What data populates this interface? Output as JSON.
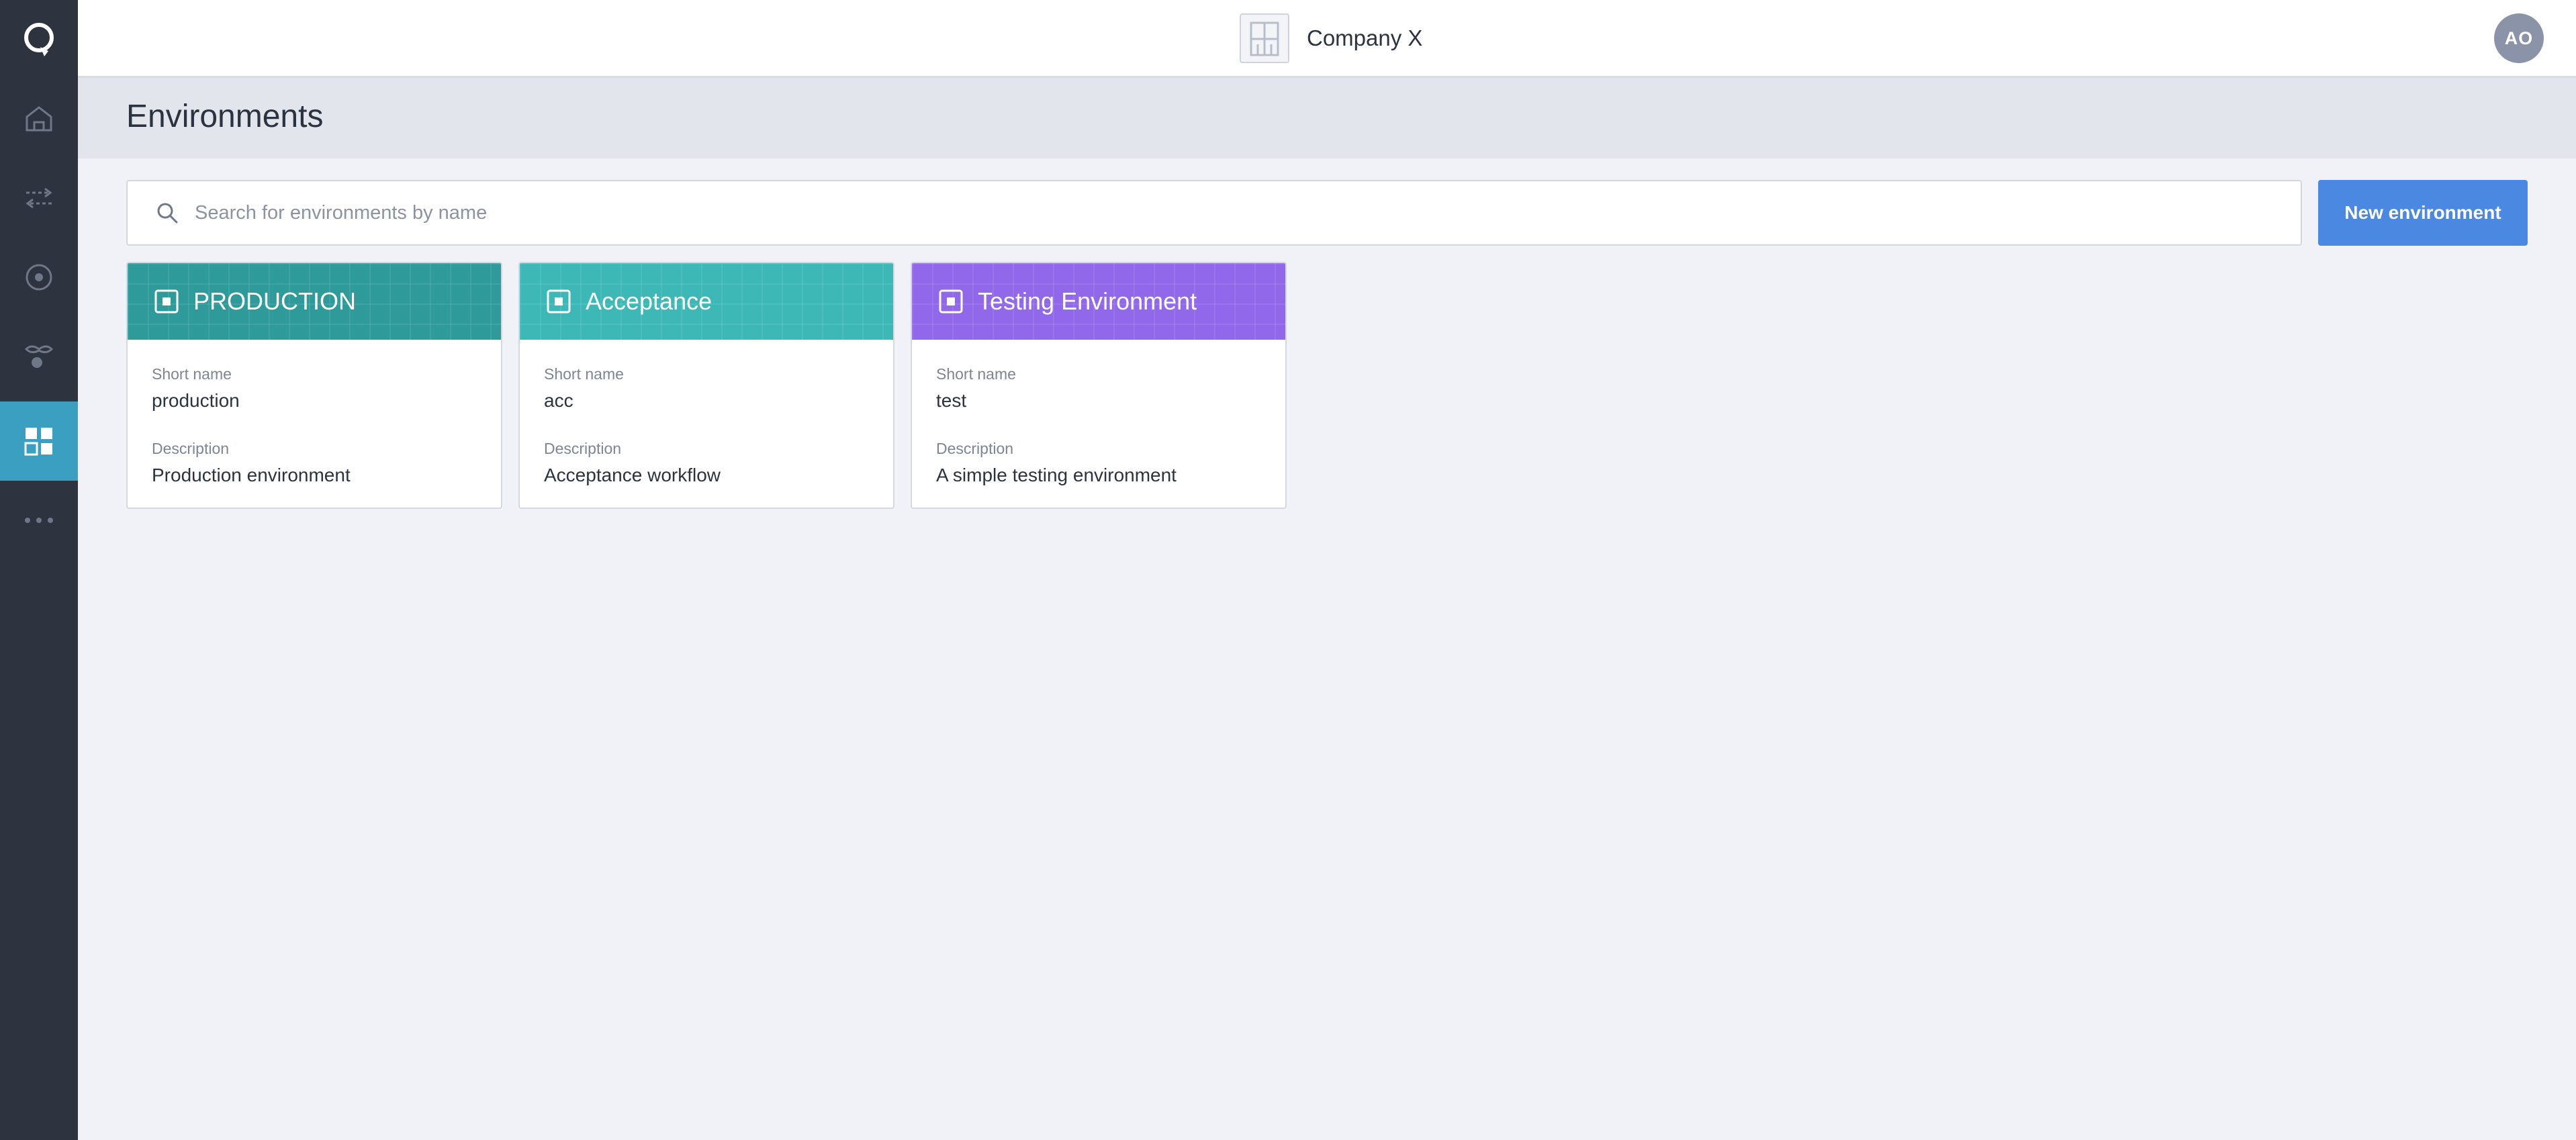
{
  "header": {
    "company_name": "Company X",
    "avatar_initials": "AO"
  },
  "sidebar": {
    "items": [
      {
        "icon": "logo-icon"
      },
      {
        "icon": "home-icon"
      },
      {
        "icon": "transfer-arrows-icon"
      },
      {
        "icon": "target-icon"
      },
      {
        "icon": "integration-icon"
      },
      {
        "icon": "dashboard-grid-icon",
        "active": true
      },
      {
        "icon": "more-dots-icon"
      }
    ]
  },
  "page": {
    "title": "Environments"
  },
  "search": {
    "placeholder": "Search for environments by name",
    "value": ""
  },
  "actions": {
    "new_environment_label": "New environment"
  },
  "environments": [
    {
      "name": "PRODUCTION",
      "short_name_label": "Short name",
      "short_name": "production",
      "description_label": "Description",
      "description": "Production environment",
      "color": "#2e9b9a"
    },
    {
      "name": "Acceptance",
      "short_name_label": "Short name",
      "short_name": "acc",
      "description_label": "Description",
      "description": "Acceptance workflow",
      "color": "#3db8b7"
    },
    {
      "name": "Testing Environment",
      "short_name_label": "Short name",
      "short_name": "test",
      "description_label": "Description",
      "description": "A simple testing environment",
      "color": "#9268ea"
    }
  ]
}
